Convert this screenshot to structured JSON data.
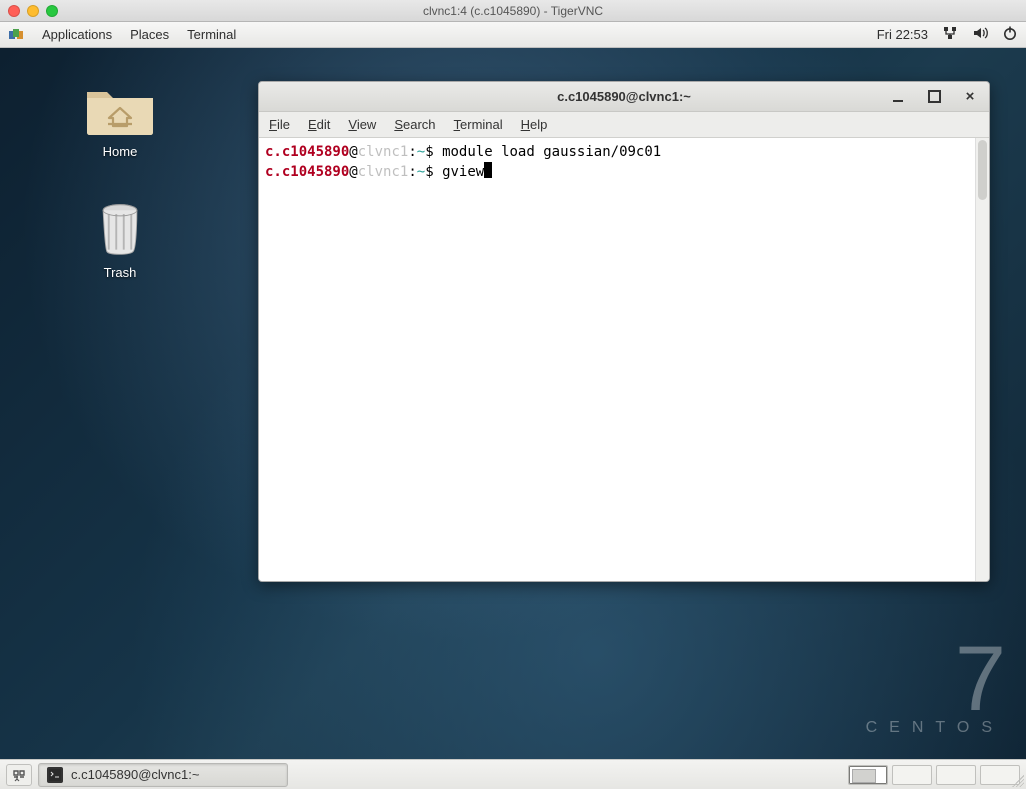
{
  "mac": {
    "title": "clvnc1:4 (c.c1045890) - TigerVNC"
  },
  "topbar": {
    "applications": "Applications",
    "places": "Places",
    "active_app": "Terminal",
    "clock": "Fri 22:53"
  },
  "desktop_icons": {
    "home": "Home",
    "trash": "Trash"
  },
  "centos": {
    "seven": "7",
    "name": "CENTOS"
  },
  "terminal": {
    "title": "c.c1045890@clvnc1:~",
    "menus": {
      "file": "File",
      "edit": "Edit",
      "view": "View",
      "search": "Search",
      "terminal": "Terminal",
      "help": "Help"
    },
    "prompt": {
      "user": "c.c1045890",
      "at": "@",
      "host": "clvnc1",
      "colon": ":",
      "tilde": "~",
      "dollar": "$"
    },
    "lines": [
      {
        "cmd": "module load gaussian/09c01"
      },
      {
        "cmd": "gview"
      }
    ]
  },
  "taskbar": {
    "task_label": "c.c1045890@clvnc1:~"
  }
}
